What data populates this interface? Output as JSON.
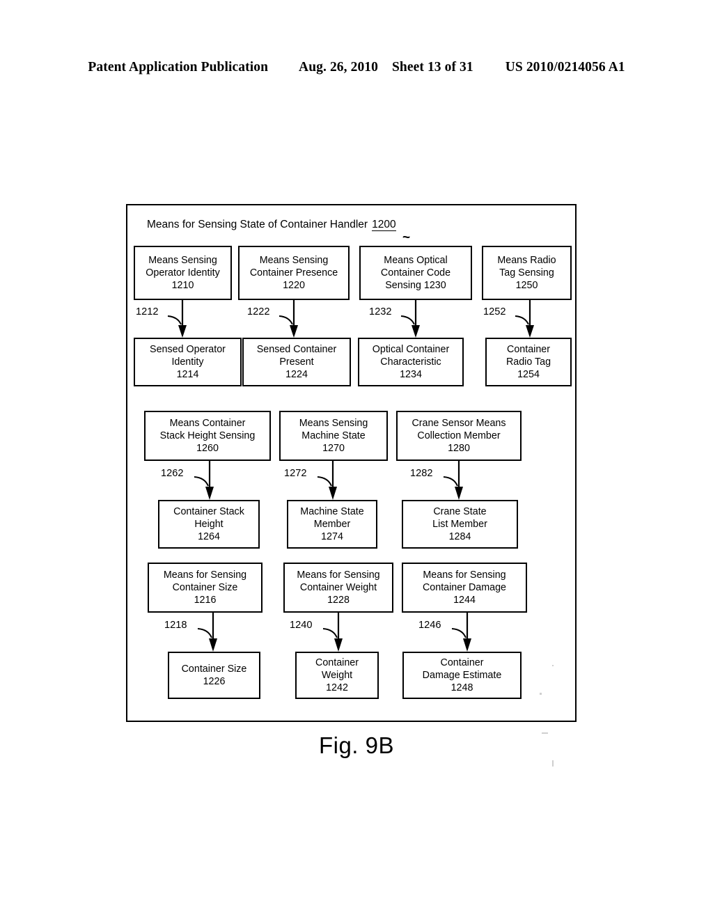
{
  "header": {
    "publication": "Patent Application Publication",
    "date": "Aug. 26, 2010",
    "sheet": "Sheet 13 of 31",
    "patent_number": "US 2010/0214056 A1"
  },
  "figure": {
    "caption": "Fig. 9B",
    "frame_title": "Means for Sensing State of Container Handler",
    "frame_ref": "1200",
    "tilde": "~"
  },
  "nodes": [
    {
      "id": "n1210",
      "lines": [
        "Means Sensing",
        "Operator Identity",
        "1210"
      ]
    },
    {
      "id": "n1220",
      "lines": [
        "Means Sensing",
        "Container Presence",
        "1220"
      ]
    },
    {
      "id": "n1230",
      "lines": [
        "Means  Optical",
        "Container Code",
        "Sensing 1230"
      ]
    },
    {
      "id": "n1250",
      "lines": [
        "Means Radio",
        "Tag Sensing",
        "1250"
      ]
    },
    {
      "id": "n1214",
      "lines": [
        "Sensed Operator",
        "Identity",
        "1214"
      ]
    },
    {
      "id": "n1224",
      "lines": [
        "Sensed Container",
        "Present",
        "1224"
      ]
    },
    {
      "id": "n1234",
      "lines": [
        "Optical Container",
        "Characteristic",
        "1234"
      ]
    },
    {
      "id": "n1254",
      "lines": [
        "Container",
        "Radio Tag",
        "1254"
      ]
    },
    {
      "id": "n1260",
      "lines": [
        "Means Container",
        "Stack Height Sensing",
        "1260"
      ]
    },
    {
      "id": "n1270",
      "lines": [
        "Means Sensing",
        "Machine State",
        "1270"
      ]
    },
    {
      "id": "n1280",
      "lines": [
        "Crane Sensor Means",
        "Collection Member",
        "1280"
      ]
    },
    {
      "id": "n1264",
      "lines": [
        "Container Stack",
        "Height",
        "1264"
      ]
    },
    {
      "id": "n1274",
      "lines": [
        "Machine State",
        "Member",
        "1274"
      ]
    },
    {
      "id": "n1284",
      "lines": [
        "Crane State",
        "List Member",
        "1284"
      ]
    },
    {
      "id": "n1216",
      "lines": [
        "Means for Sensing",
        "Container Size",
        "1216"
      ]
    },
    {
      "id": "n1228",
      "lines": [
        "Means for Sensing",
        "Container Weight",
        "1228"
      ]
    },
    {
      "id": "n1244",
      "lines": [
        "Means for Sensing",
        "Container Damage",
        "1244"
      ]
    },
    {
      "id": "n1226",
      "lines": [
        "Container Size",
        "1226"
      ]
    },
    {
      "id": "n1242",
      "lines": [
        "Container",
        "Weight",
        "1242"
      ]
    },
    {
      "id": "n1248",
      "lines": [
        "Container",
        "Damage Estimate",
        "1248"
      ]
    }
  ],
  "connectors": [
    {
      "id": "c1212",
      "label": "1212",
      "from": "n1210",
      "to": "n1214"
    },
    {
      "id": "c1222",
      "label": "1222",
      "from": "n1220",
      "to": "n1224"
    },
    {
      "id": "c1232",
      "label": "1232",
      "from": "n1230",
      "to": "n1234"
    },
    {
      "id": "c1252",
      "label": "1252",
      "from": "n1250",
      "to": "n1254"
    },
    {
      "id": "c1262",
      "label": "1262",
      "from": "n1260",
      "to": "n1264"
    },
    {
      "id": "c1272",
      "label": "1272",
      "from": "n1270",
      "to": "n1274"
    },
    {
      "id": "c1282",
      "label": "1282",
      "from": "n1280",
      "to": "n1284"
    },
    {
      "id": "c1218",
      "label": "1218",
      "from": "n1216",
      "to": "n1226"
    },
    {
      "id": "c1240",
      "label": "1240",
      "from": "n1228",
      "to": "n1242"
    },
    {
      "id": "c1246",
      "label": "1246",
      "from": "n1244",
      "to": "n1248"
    }
  ]
}
